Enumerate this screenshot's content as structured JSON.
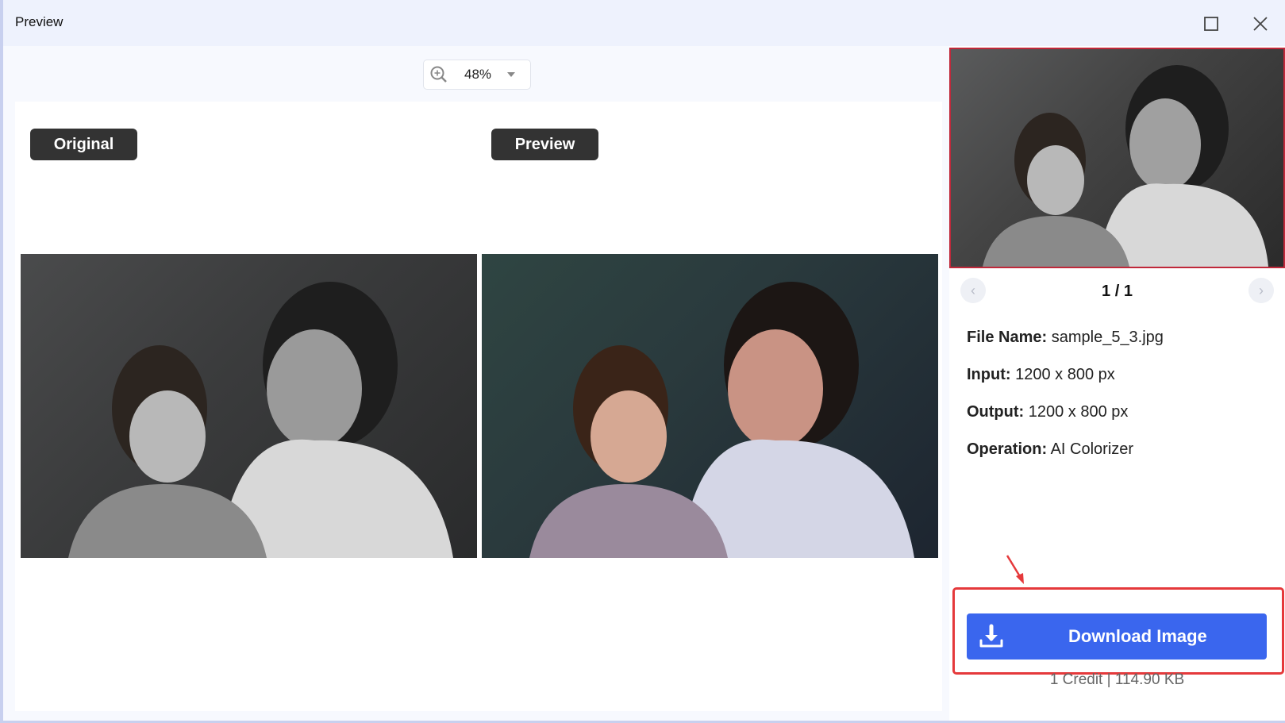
{
  "window": {
    "title": "Preview"
  },
  "window_controls": {
    "maximize": "maximize-icon",
    "close": "close-icon"
  },
  "zoom": {
    "icon": "zoom-in-icon",
    "value": "48%"
  },
  "canvas": {
    "original_label": "Original",
    "preview_label": "Preview",
    "original_image_alt": "Black and white photo of woman and child",
    "preview_image_alt": "Colorized photo of woman and child"
  },
  "side_panel": {
    "page_indicator": "1 / 1",
    "info": [
      {
        "key": "File Name:",
        "value": "sample_5_3.jpg"
      },
      {
        "key": "Input:",
        "value": "1200 x 800 px"
      },
      {
        "key": "Output:",
        "value": "1200 x 800 px"
      },
      {
        "key": "Operation:",
        "value": "AI Colorizer"
      }
    ],
    "download_label": "Download Image",
    "credit_info": "1 Credit | 114.90 KB"
  },
  "colors": {
    "accent": "#3a66ee",
    "highlight": "#e5393b",
    "label_bg": "#333333"
  }
}
